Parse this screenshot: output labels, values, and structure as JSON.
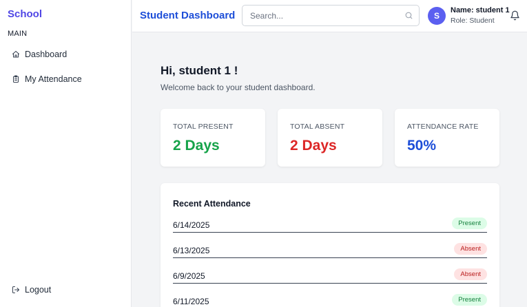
{
  "sidebar": {
    "brand": "School",
    "section_label": "MAIN",
    "items": [
      {
        "label": "Dashboard",
        "icon": "home-icon"
      },
      {
        "label": "My Attendance",
        "icon": "clipboard-icon"
      }
    ],
    "logout_label": "Logout"
  },
  "header": {
    "title": "Student Dashboard",
    "search_placeholder": "Search...",
    "search_value": "",
    "avatar_initial": "S",
    "user_name": "Name: student 1",
    "user_role": "Role: Student"
  },
  "main": {
    "greeting": "Hi, student 1 !",
    "subgreeting": "Welcome back to your student dashboard.",
    "cards": [
      {
        "label": "TOTAL PRESENT",
        "value": "2 Days",
        "color": "#16a34a"
      },
      {
        "label": "TOTAL ABSENT",
        "value": "2 Days",
        "color": "#dc2626"
      },
      {
        "label": "ATTENDANCE RATE",
        "value": "50%",
        "color": "#1d4ed8"
      }
    ],
    "recent": {
      "title": "Recent Attendance",
      "rows": [
        {
          "date": "6/14/2025",
          "status": "Present"
        },
        {
          "date": "6/13/2025",
          "status": "Absent"
        },
        {
          "date": "6/9/2025",
          "status": "Absent"
        },
        {
          "date": "6/11/2025",
          "status": "Present"
        }
      ]
    }
  },
  "colors": {
    "brand": "#4f46e5",
    "title": "#1d4ed8",
    "avatar": "#5b5ff0"
  }
}
